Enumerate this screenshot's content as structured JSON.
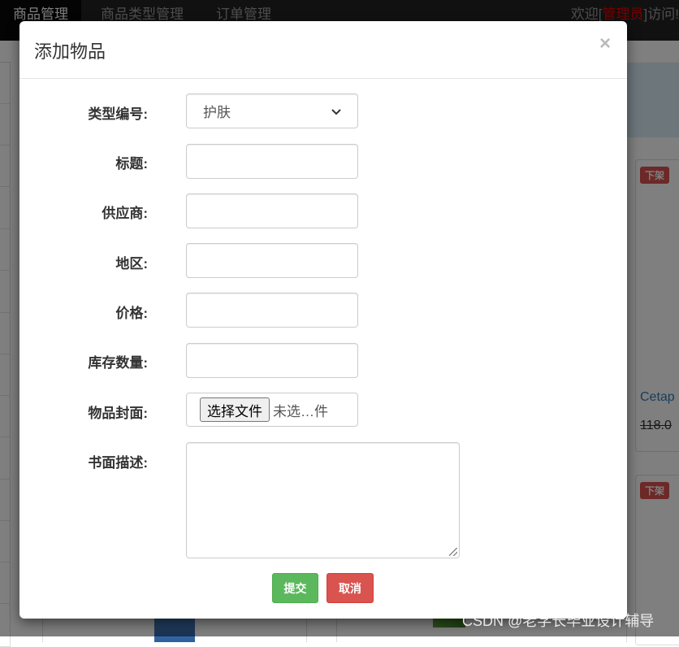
{
  "navbar": {
    "items": [
      "商品管理",
      "商品类型管理",
      "订单管理"
    ],
    "welcome_prefix": "欢迎[",
    "welcome_user": "管理员",
    "welcome_suffix": "]访问!"
  },
  "background": {
    "badge_1": "下架",
    "badge_2": "下架",
    "card_title": "Cetap",
    "card_price": "118.0"
  },
  "modal": {
    "title": "添加物品",
    "close_symbol": "×",
    "fields": {
      "type_label": "类型编号:",
      "type_value": "护肤",
      "title_label": "标题:",
      "supplier_label": "供应商:",
      "region_label": "地区:",
      "price_label": "价格:",
      "stock_label": "库存数量:",
      "cover_label": "物品封面:",
      "file_button": "选择文件",
      "file_text": "未选…件",
      "desc_label": "书面描述:"
    },
    "buttons": {
      "submit": "提交",
      "cancel": "取消"
    }
  },
  "watermark": "CSDN @老学长毕业设计辅导",
  "colors": {
    "navbar": "#222222",
    "submit": "#5cb85c",
    "cancel": "#d9534f",
    "admin": "#ee0000"
  }
}
